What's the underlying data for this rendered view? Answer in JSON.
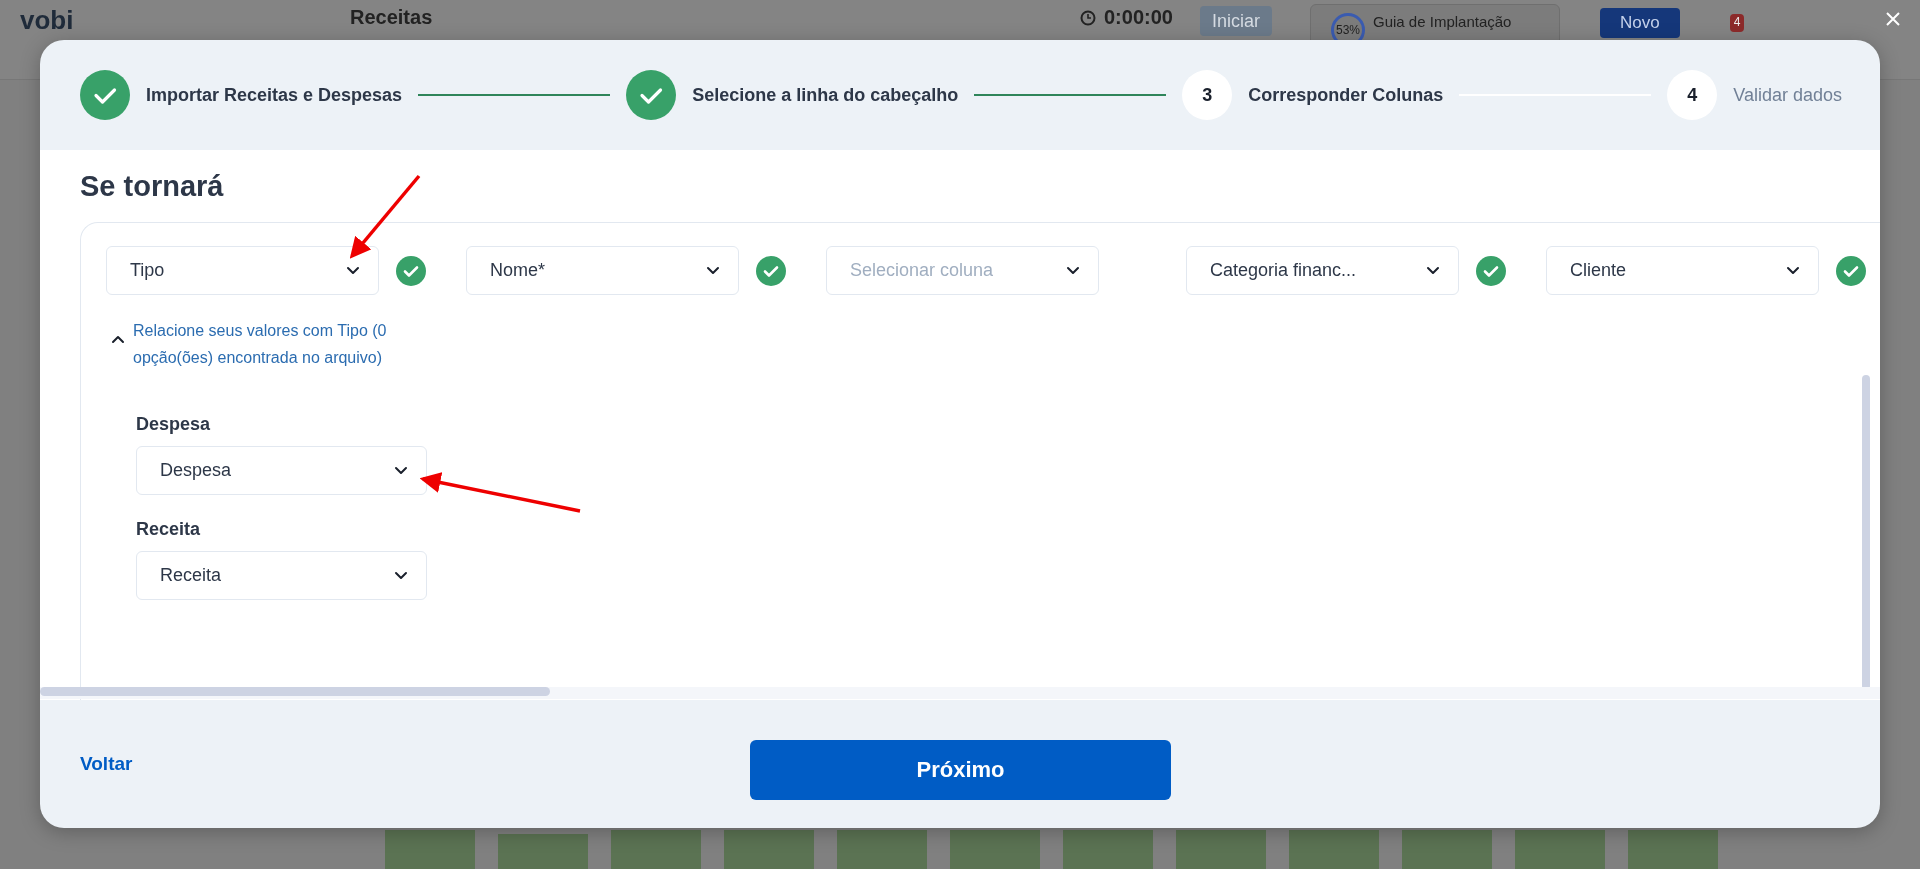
{
  "background": {
    "logo": "vobi",
    "page_title": "Receitas",
    "timer": "0:00:00",
    "start_button": "Iniciar",
    "guide_percent": "53%",
    "guide_label": "Guia de Implantação",
    "new_button": "Novo",
    "notification_count": "4"
  },
  "steps": [
    {
      "label": "Importar Receitas e Despesas",
      "completed": true
    },
    {
      "label": "Selecione a linha do cabeçalho",
      "completed": true
    },
    {
      "label": "Corresponder Colunas",
      "number": "3",
      "completed": false,
      "active": true
    },
    {
      "label": "Validar dados",
      "number": "4",
      "completed": false,
      "active": false
    }
  ],
  "section_title": "Se tornará",
  "columns": [
    {
      "value": "Tipo",
      "matched": true
    },
    {
      "value": "Nome*",
      "matched": true
    },
    {
      "placeholder": "Selecionar coluna",
      "matched": false
    },
    {
      "value": "Categoria financ...",
      "matched": true
    },
    {
      "value": "Cliente",
      "matched": true
    }
  ],
  "value_mapping": {
    "expanded": true,
    "text": "Relacione seus valores com Tipo (0 opção(ões) encontrada no arquivo)",
    "items": [
      {
        "label": "Despesa",
        "value": "Despesa"
      },
      {
        "label": "Receita",
        "value": "Receita"
      }
    ]
  },
  "footer": {
    "back": "Voltar",
    "next": "Próximo"
  }
}
